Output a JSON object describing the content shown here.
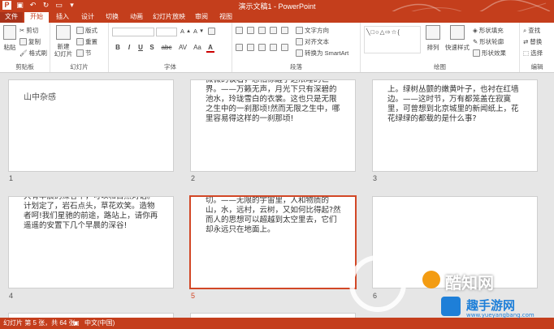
{
  "window": {
    "title": "演示文稿1 - PowerPoint"
  },
  "qat": {
    "icons": [
      "powerpoint-logo-icon",
      "save-icon",
      "undo-icon",
      "redo-icon",
      "present-icon",
      "customize-qat-icon"
    ]
  },
  "tabs": [
    {
      "label": "文件",
      "active": false
    },
    {
      "label": "开始",
      "active": true
    },
    {
      "label": "插入",
      "active": false
    },
    {
      "label": "设计",
      "active": false
    },
    {
      "label": "切换",
      "active": false
    },
    {
      "label": "动画",
      "active": false
    },
    {
      "label": "幻灯片放映",
      "active": false
    },
    {
      "label": "审阅",
      "active": false
    },
    {
      "label": "视图",
      "active": false
    }
  ],
  "ribbon": {
    "clipboard": {
      "label": "剪贴板",
      "paste": "粘贴",
      "cut": "剪切",
      "copy": "复制",
      "format_painter": "格式刷"
    },
    "slides": {
      "label": "幻灯片",
      "new_slide": "新建\n幻灯片",
      "layout": "版式",
      "reset": "重置",
      "section": "节"
    },
    "font": {
      "label": "字体",
      "buttons": [
        "B",
        "I",
        "U",
        "S",
        "abc",
        "AV",
        "Aa",
        "A"
      ]
    },
    "paragraph": {
      "label": "段落",
      "text_direction": "文字方向",
      "align_text": "对齐文本",
      "convert_smartart": "转换为 SmartArt"
    },
    "drawing": {
      "label": "绘图",
      "arrange": "排列",
      "quick_styles": "快速样式",
      "shape_fill": "形状填充",
      "shape_outline": "形状轮廓",
      "shape_effects": "形状效果"
    },
    "editing": {
      "label": "编辑",
      "find": "查找",
      "replace": "替换",
      "select": "选择"
    }
  },
  "slides": [
    {
      "number": "1",
      "text": "山中杂感",
      "selected": false
    },
    {
      "number": "2",
      "text": "微微的谈着，恐怕惊醒了这浓睡的世界。——万籁无声，月光下只有深碧的池水，玲珑雪白的衣裳。这也只是无限之生中的一刹那顷!然而无限之生中，哪里容易得这样的一刹那顷!",
      "selected": false
    },
    {
      "number": "3",
      "text": "上。绿树丛颤的嫩黄叶子，也衬在红墙边。——这时节，万有都笼盖在寂寞里，可曾想到北京城里的新闻纸上，花花绿绿的都载的是什么事?",
      "selected": false
    },
    {
      "number": "4",
      "text": "只有早晨的深谷中，可以和自然对话。计划定了，岩石点头，草花欢笑。造物者呵!我们星驰的前途，路站上，请你再遥遥的安置下几个早晨的深谷!",
      "selected": false
    },
    {
      "number": "5",
      "text": "切。——无限的宇宙里，人和物质的山，水，远村，云树，又如何比得起?然而人的思想可以超越到太空里去，它们却永远只在地面上。",
      "selected": true
    },
    {
      "number": "6",
      "text": "",
      "selected": false
    }
  ],
  "status": {
    "slide_info": "幻灯片 第 5 张，共 64 张",
    "language": "中文(中国)"
  },
  "watermark": {
    "brand": "酷知网",
    "brand2": "趣手游网",
    "url": "www.yueyangbang.com"
  },
  "colors": {
    "accent": "#c43e1c",
    "selected_border": "#d24726"
  }
}
